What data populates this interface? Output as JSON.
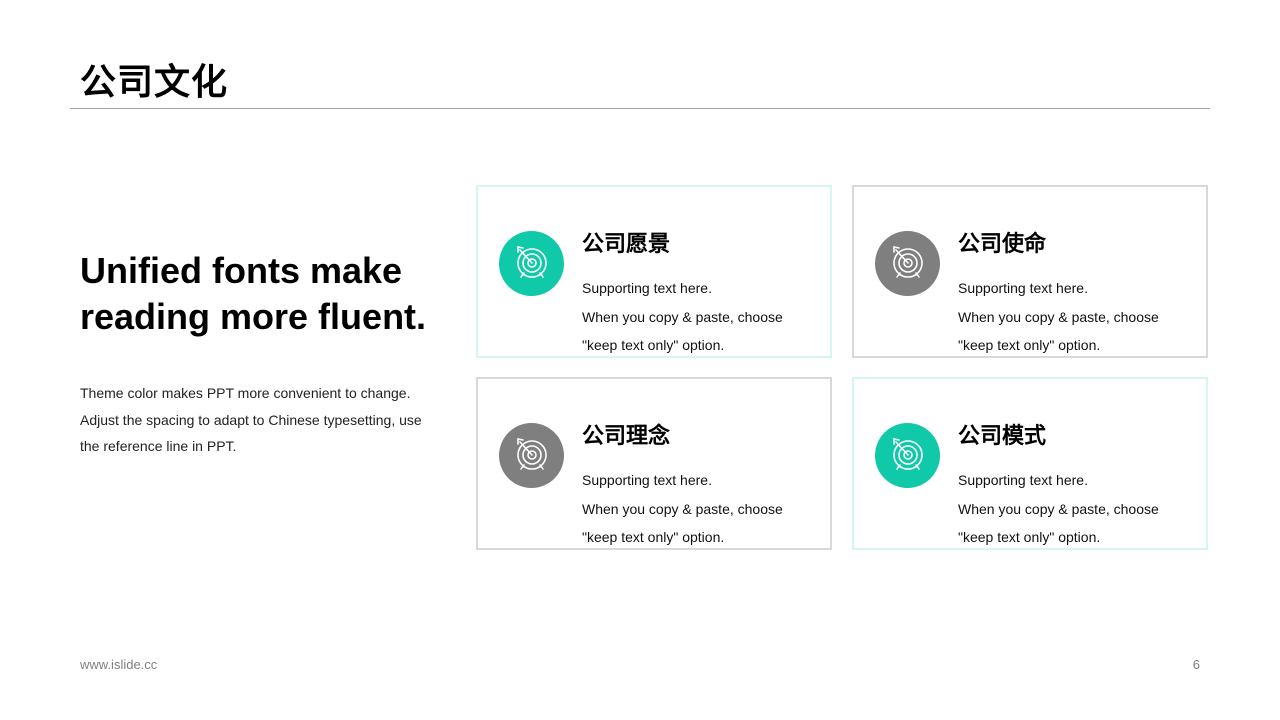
{
  "title": "公司文化",
  "headline": {
    "line1": "Unified fonts make",
    "line2": "reading more fluent."
  },
  "description": {
    "line1": "Theme color makes PPT more convenient to change.",
    "line2": "Adjust the spacing to adapt to Chinese typesetting, use",
    "line3": "the reference line in PPT."
  },
  "colors": {
    "accent": "#10c9a9",
    "neutral": "#7f7f7f",
    "accent_border": "#d4f7f4",
    "neutral_border": "#d9d9d9"
  },
  "cards": [
    {
      "title": "公司愿景",
      "line1": "Supporting text here.",
      "line2": "When you copy & paste, choose",
      "line3": "\"keep text only\" option.",
      "icon": "target-icon",
      "color": "#10c9a9"
    },
    {
      "title": "公司使命",
      "line1": "Supporting text here.",
      "line2": "When you copy & paste, choose",
      "line3": "\"keep text only\" option.",
      "icon": "target-icon",
      "color": "#7f7f7f"
    },
    {
      "title": "公司理念",
      "line1": "Supporting text here.",
      "line2": "When you copy & paste, choose",
      "line3": "\"keep text only\" option.",
      "icon": "target-icon",
      "color": "#7f7f7f"
    },
    {
      "title": "公司模式",
      "line1": "Supporting text here.",
      "line2": "When you copy & paste, choose",
      "line3": "\"keep text only\" option.",
      "icon": "target-icon",
      "color": "#10c9a9"
    }
  ],
  "footer": {
    "url": "www.islide.cc",
    "page": "6"
  }
}
